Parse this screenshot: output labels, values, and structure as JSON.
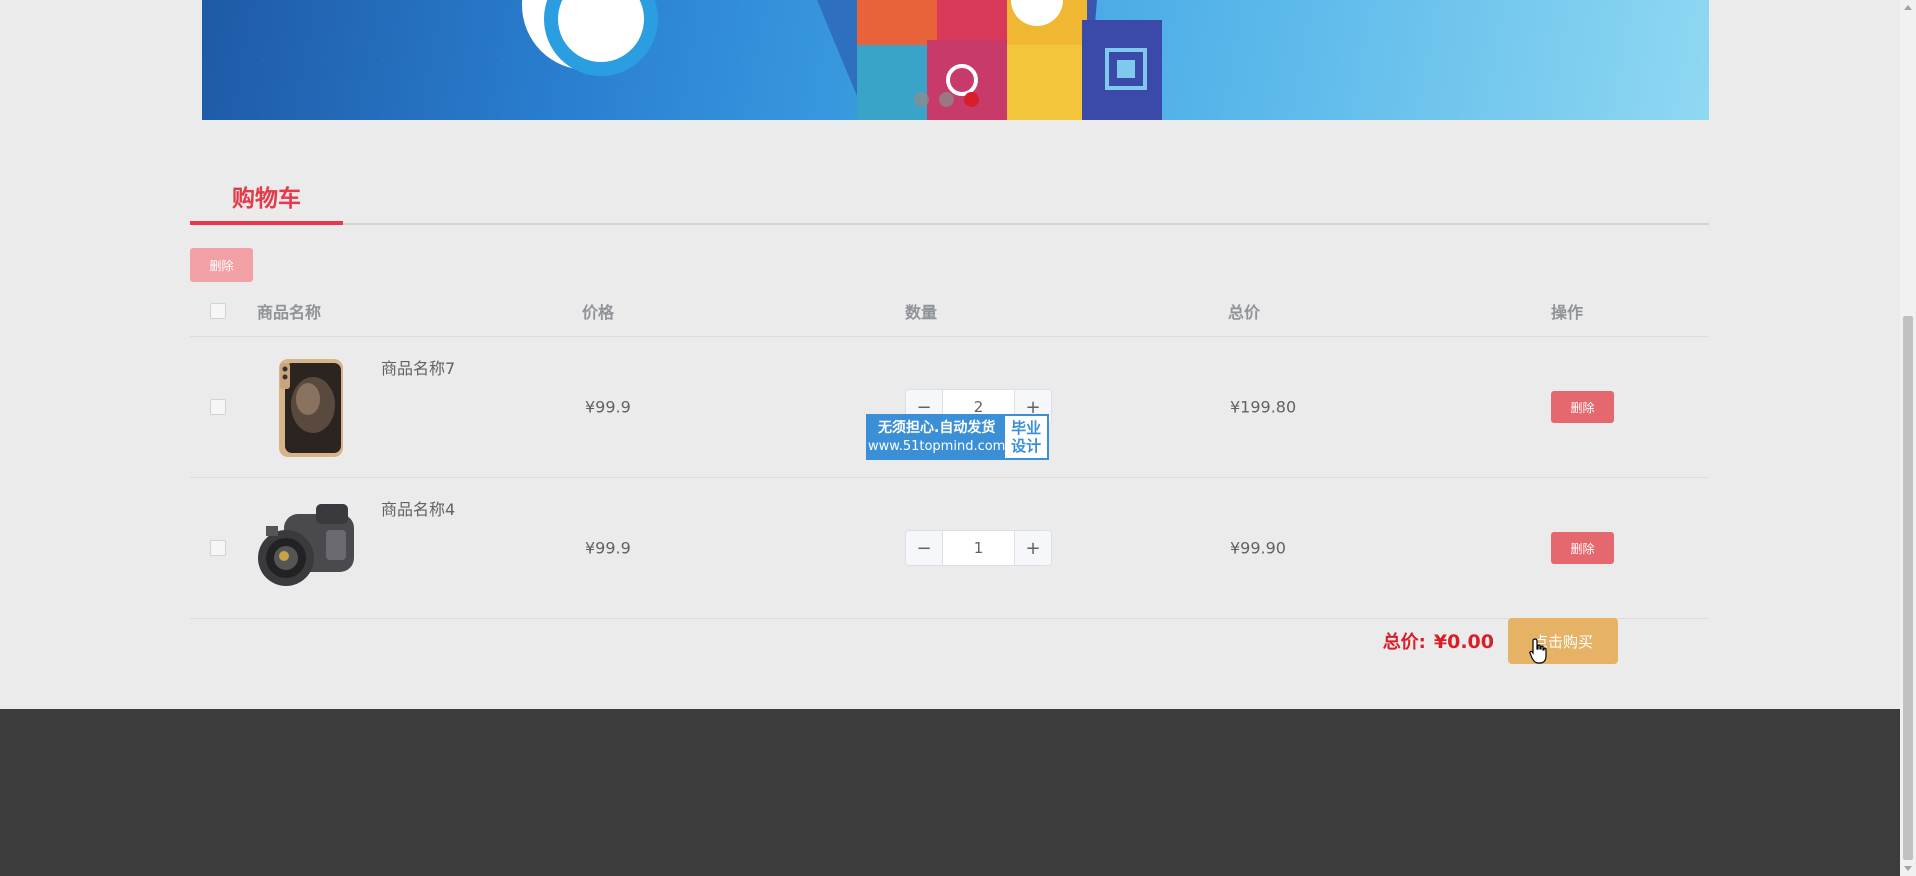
{
  "banner": {
    "carousel_dots": 3,
    "active_dot": 3
  },
  "cart": {
    "title": "购物车",
    "batch_delete_label": "删除",
    "columns": [
      "商品名称",
      "价格",
      "数量",
      "总价",
      "操作"
    ],
    "items": [
      {
        "name": "商品名称7",
        "price": "¥99.9",
        "quantity": "2",
        "total": "¥199.80",
        "delete_label": "删除",
        "image_icon": "smartphone-image"
      },
      {
        "name": "商品名称4",
        "price": "¥99.9",
        "quantity": "1",
        "total": "¥99.90",
        "delete_label": "删除",
        "image_icon": "camcorder-image"
      }
    ],
    "minus_symbol": "−",
    "plus_symbol": "+",
    "total_label": "总价:",
    "total_amount": "¥0.00",
    "buy_label": "点击购买"
  },
  "watermark": {
    "line1": "无须担心.自动发货",
    "line2": "www.51topmind.com",
    "badge_line1": "毕业",
    "badge_line2": "设计"
  },
  "colors": {
    "accent_red": "#e53a4a",
    "delete_button": "#e5686f",
    "buy_button": "#e6b266",
    "footer": "#3c3c3c"
  }
}
